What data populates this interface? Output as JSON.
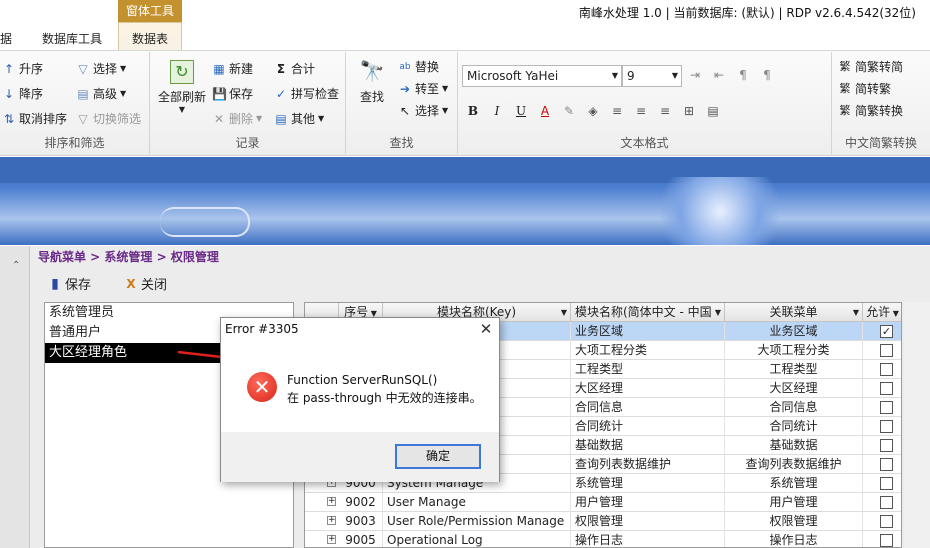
{
  "titlebar": {
    "context_tab": "窗体工具",
    "app_title": "南峰水处理 1.0 | 当前数据库: (默认) | RDP v2.6.4.542(32位)"
  },
  "tabs": [
    "据",
    "数据库工具",
    "数据表"
  ],
  "ribbon": {
    "sort_filter": {
      "label": "排序和筛选",
      "asc": "升序",
      "desc": "降序",
      "clear_sort": "取消排序",
      "select": "选择",
      "advanced": "高级",
      "toggle_filter": "切换筛选"
    },
    "records": {
      "label": "记录",
      "refresh_all": "全部刷新",
      "new": "新建",
      "save": "保存",
      "delete": "删除",
      "total": "合计",
      "spelling": "拼写检查",
      "more": "其他"
    },
    "find": {
      "label": "查找",
      "find": "查找",
      "replace": "替换",
      "goto": "转至",
      "select": "选择"
    },
    "text_format": {
      "label": "文本格式",
      "font": "Microsoft YaHei",
      "size": "9"
    },
    "chinese": {
      "label": "中文简繁转换",
      "to_trad": "简繁转简",
      "to_simp": "简转繁",
      "convert": "简繁转换"
    }
  },
  "nav": {
    "breadcrumb": "导航菜单 > 系统管理 > 权限管理",
    "save": "保存",
    "close": "关闭"
  },
  "roles": [
    "系统管理员",
    "普通用户",
    "大区经理角色"
  ],
  "grid": {
    "headers": [
      "序号",
      "模块名称(Key)",
      "模块名称(简体中文 - 中国",
      "关联菜单",
      "允许"
    ],
    "rows": [
      {
        "id": "",
        "key": "",
        "cn": "业务区域",
        "menu": "业务区域",
        "allow": true
      },
      {
        "id": "",
        "key": "",
        "cn": "大项工程分类",
        "menu": "大项工程分类",
        "allow": false
      },
      {
        "id": "",
        "key": "",
        "cn": "工程类型",
        "menu": "工程类型",
        "allow": false
      },
      {
        "id": "",
        "key": "",
        "cn": "大区经理",
        "menu": "大区经理",
        "allow": false
      },
      {
        "id": "",
        "key": "",
        "cn": "合同信息",
        "menu": "合同信息",
        "allow": false
      },
      {
        "id": "",
        "key": "",
        "cn": "合同统计",
        "menu": "合同统计",
        "allow": false
      },
      {
        "id": "",
        "key": "",
        "cn": "基础数据",
        "menu": "基础数据",
        "allow": false
      },
      {
        "id": "",
        "key": "aintain",
        "cn": "查询列表数据维护",
        "menu": "查询列表数据维护",
        "allow": false
      },
      {
        "id": "9000",
        "key": "System Manage",
        "cn": "系统管理",
        "menu": "系统管理",
        "allow": false
      },
      {
        "id": "9002",
        "key": "User Manage",
        "cn": "用户管理",
        "menu": "用户管理",
        "allow": false
      },
      {
        "id": "9003",
        "key": "User Role/Permission Manage",
        "cn": "权限管理",
        "menu": "权限管理",
        "allow": false
      },
      {
        "id": "9005",
        "key": "Operational Log",
        "cn": "操作日志",
        "menu": "操作日志",
        "allow": false
      }
    ]
  },
  "dialog": {
    "title": "Error #3305",
    "message_line1": "Function ServerRunSQL()",
    "message_line2": "在 pass-through 中无效的连接串。",
    "ok": "确定"
  }
}
